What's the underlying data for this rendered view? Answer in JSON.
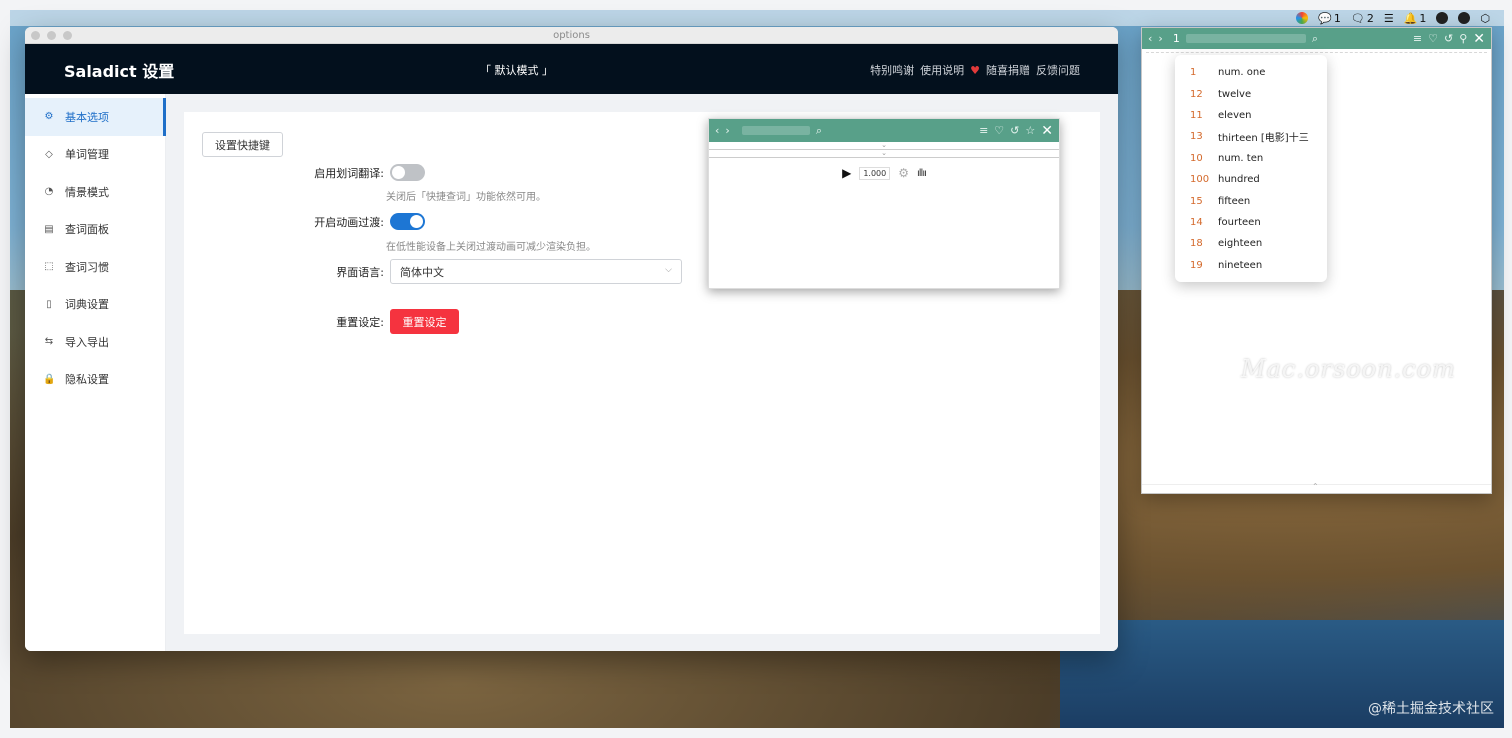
{
  "menubar": {
    "tray_items": [
      {
        "icon": "color-wheel-icon",
        "text": ""
      },
      {
        "icon": "wechat-icon",
        "text": "1"
      },
      {
        "icon": "chat-bubbles-icon",
        "text": "2"
      },
      {
        "icon": "stack-icon",
        "text": ""
      },
      {
        "icon": "qq-icon",
        "text": "1"
      },
      {
        "icon": "robot-icon",
        "text": ""
      },
      {
        "icon": "face-icon",
        "text": ""
      },
      {
        "icon": "box-icon",
        "text": ""
      }
    ]
  },
  "window": {
    "title": "options"
  },
  "header": {
    "app_title": "Saladict 设置",
    "mode": "「 默认模式 」",
    "links": {
      "thanks": "特别鸣谢",
      "manual": "使用说明",
      "donate": "随喜捐赠",
      "feedback": "反馈问题"
    }
  },
  "sidebar": {
    "items": [
      {
        "label": "基本选项",
        "icon": "gear-icon",
        "active": true
      },
      {
        "label": "单词管理",
        "icon": "tag-icon",
        "active": false
      },
      {
        "label": "情景模式",
        "icon": "dashboard-icon",
        "active": false
      },
      {
        "label": "查词面板",
        "icon": "panel-icon",
        "active": false
      },
      {
        "label": "查词习惯",
        "icon": "select-icon",
        "active": false
      },
      {
        "label": "词典设置",
        "icon": "book-icon",
        "active": false
      },
      {
        "label": "导入导出",
        "icon": "swap-icon",
        "active": false
      },
      {
        "label": "隐私设置",
        "icon": "lock-icon",
        "active": false
      }
    ]
  },
  "form": {
    "shortcut_button": "设置快捷键",
    "selection_translate": {
      "label": "启用划词翻译:",
      "enabled": false,
      "help": "关闭后「快捷查词」功能依然可用。"
    },
    "animation": {
      "label": "开启动画过渡:",
      "enabled": true,
      "help": "在低性能设备上关闭过渡动画可减少渲染负担。"
    },
    "language": {
      "label": "界面语言:",
      "value": "简体中文"
    },
    "reset": {
      "label": "重置设定:",
      "button": "重置设定"
    }
  },
  "preview": {
    "rate": "1.000"
  },
  "dict_window": {
    "search_value": "1"
  },
  "suggestions": [
    {
      "num": "1",
      "word": "num. one"
    },
    {
      "num": "12",
      "word": "twelve"
    },
    {
      "num": "11",
      "word": "eleven"
    },
    {
      "num": "13",
      "word": "thirteen [电影]十三"
    },
    {
      "num": "10",
      "word": "num. ten"
    },
    {
      "num": "100",
      "word": "hundred"
    },
    {
      "num": "15",
      "word": "fifteen"
    },
    {
      "num": "14",
      "word": "fourteen"
    },
    {
      "num": "18",
      "word": "eighteen"
    },
    {
      "num": "19",
      "word": "nineteen"
    }
  ],
  "watermark": "Mac.orsoon.com",
  "credit": "@稀土掘金技术社区",
  "colors": {
    "header_bg": "#03101d",
    "accent": "#1d76d4",
    "dict_green": "#58a089",
    "reset_red": "#f5333f",
    "suggest_num": "#d4692b"
  }
}
